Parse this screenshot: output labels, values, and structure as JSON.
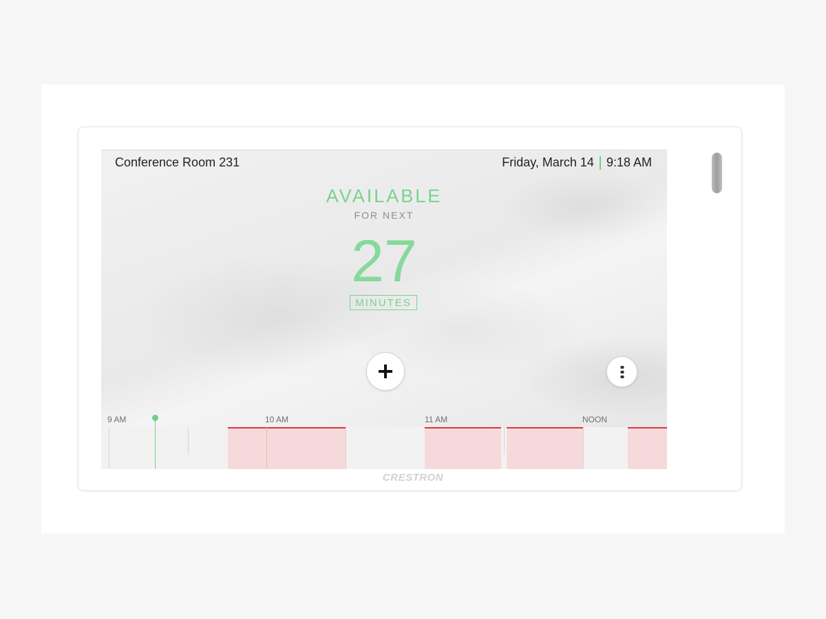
{
  "header": {
    "room_name": "Conference Room 231",
    "date": "Friday, March 14",
    "time": "9:18 AM"
  },
  "status": {
    "state": "AVAILABLE",
    "subtitle": "FOR NEXT",
    "minutes": "27",
    "unit": "MINUTES"
  },
  "actions": {
    "add_icon": "plus-icon",
    "more_icon": "vertical-ellipsis-icon"
  },
  "timeline": {
    "ticks": [
      "9 AM",
      "10 AM",
      "11 AM",
      "NOON"
    ],
    "current_marker": "9:18 AM"
  },
  "device": {
    "brand": "CRESTRON"
  },
  "colors": {
    "available_green": "#77d38f",
    "booked_fill": "#f6dadb",
    "booked_border": "#d9363e"
  }
}
